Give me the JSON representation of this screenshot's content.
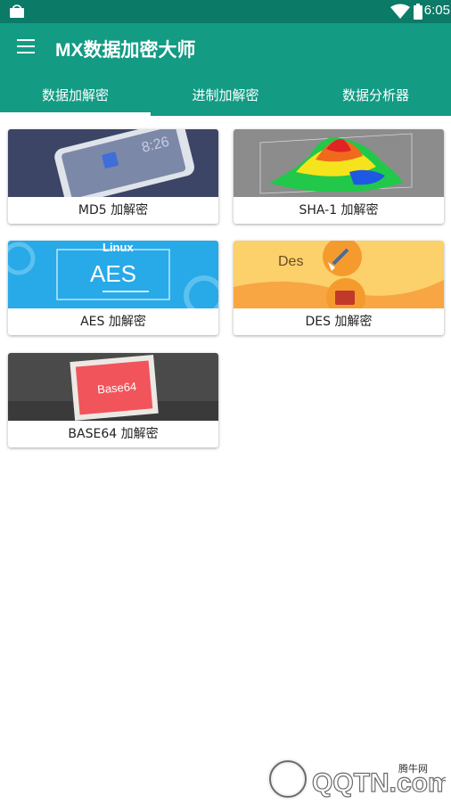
{
  "status_bar": {
    "time": "6:05"
  },
  "app_bar": {
    "title": "MX数据加密大师"
  },
  "tabs": [
    {
      "label": "数据加解密",
      "active": true
    },
    {
      "label": "进制加解密",
      "active": false
    },
    {
      "label": "数据分析器",
      "active": false
    }
  ],
  "cards": [
    {
      "label": "MD5 加解密",
      "image_text": "8:26"
    },
    {
      "label": "SHA-1 加解密"
    },
    {
      "label": "AES 加解密",
      "image_text": "AES",
      "image_badge": "Linux"
    },
    {
      "label": "DES 加解密",
      "image_text": "Des"
    },
    {
      "label": "BASE64 加解密",
      "image_text": "Base64"
    }
  ],
  "watermark": {
    "brand": "QQTN.com",
    "small": "腾牛网"
  },
  "colors": {
    "primary": "#139b84",
    "primary_dark": "#0b7a67",
    "accent": "#ffffff"
  }
}
